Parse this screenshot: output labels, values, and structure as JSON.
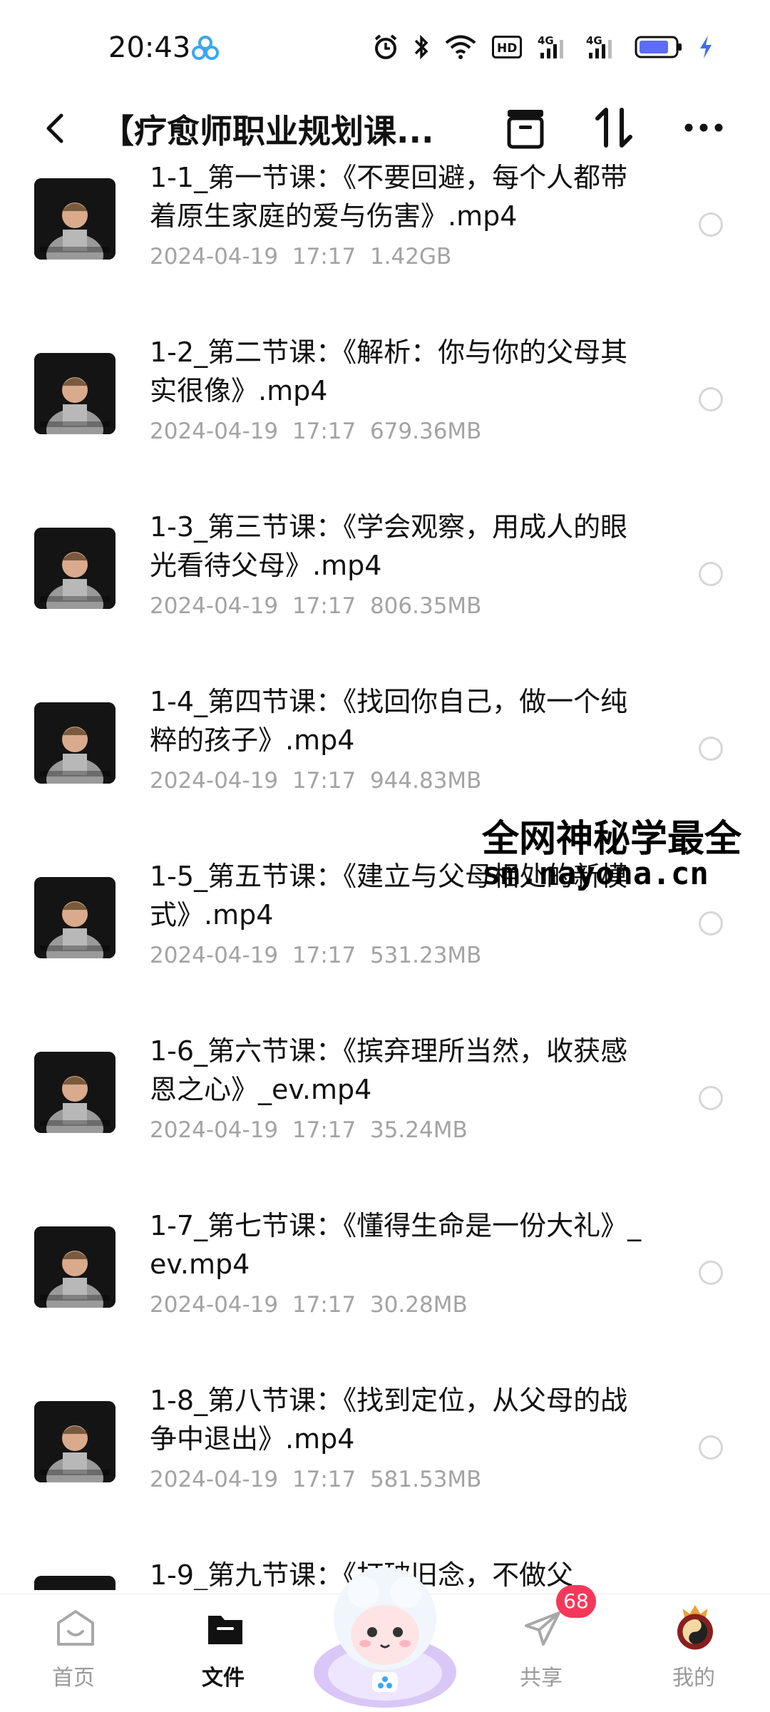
{
  "status_bar": {
    "time": "20:43",
    "icons": [
      "app-badge-icon",
      "alarm-icon",
      "bluetooth-icon",
      "wifi-icon",
      "hd-icon",
      "signal-4g-icon",
      "signal-4g-icon",
      "battery-icon",
      "charging-icon"
    ],
    "network_label_1": "4G",
    "network_label_2": "4G",
    "hd_label": "HD"
  },
  "header": {
    "title": "【疗愈师职业规划课...",
    "back_icon": "chevron-left-icon",
    "actions": [
      "folder-icon",
      "sort-icon",
      "more-icon"
    ]
  },
  "files": [
    {
      "name": "1-1_第一节课：《不要回避，每个人都带着原生家庭的爱与伤害》.mp4",
      "date": "2024-04-19",
      "time": "17:17",
      "size": "1.42GB"
    },
    {
      "name": "1-2_第二节课：《解析：你与你的父母其实很像》.mp4",
      "date": "2024-04-19",
      "time": "17:17",
      "size": "679.36MB"
    },
    {
      "name": "1-3_第三节课：《学会观察，用成人的眼光看待父母》.mp4",
      "date": "2024-04-19",
      "time": "17:17",
      "size": "806.35MB"
    },
    {
      "name": "1-4_第四节课：《找回你自己，做一个纯粹的孩子》.mp4",
      "date": "2024-04-19",
      "time": "17:17",
      "size": "944.83MB"
    },
    {
      "name": "1-5_第五节课：《建立与父母相处的新模式》.mp4",
      "date": "2024-04-19",
      "time": "17:17",
      "size": "531.23MB"
    },
    {
      "name": "1-6_第六节课：《摈弃理所当然，收获感恩之心》_ev.mp4",
      "date": "2024-04-19",
      "time": "17:17",
      "size": "35.24MB"
    },
    {
      "name": "1-7_第七节课：《懂得生命是一份大礼》_ev.mp4",
      "date": "2024-04-19",
      "time": "17:17",
      "size": "30.28MB"
    },
    {
      "name": "1-8_第八节课：《找到定位，从父母的战争中退出》.mp4",
      "date": "2024-04-19",
      "time": "17:17",
      "size": "581.53MB"
    },
    {
      "name": "1-9_第九节课：《打破旧念，不做父",
      "date": "",
      "time": "",
      "size": ""
    }
  ],
  "watermark": {
    "line1": "全网神秘学最全",
    "line2": "sm.nayona.cn"
  },
  "bottom_nav": {
    "items": [
      {
        "label": "首页",
        "icon": "home-icon"
      },
      {
        "label": "文件",
        "icon": "folder-icon"
      },
      {
        "label": "",
        "icon": "mascot-icon"
      },
      {
        "label": "共享",
        "icon": "paper-plane-icon"
      },
      {
        "label": "我的",
        "icon": "avatar-icon"
      }
    ],
    "active": "文件",
    "share_badge": "68"
  },
  "colors": {
    "text_primary": "#111111",
    "text_secondary": "#a3a3a3",
    "badge": "#f5385a",
    "battery": "#5b6cf5"
  }
}
